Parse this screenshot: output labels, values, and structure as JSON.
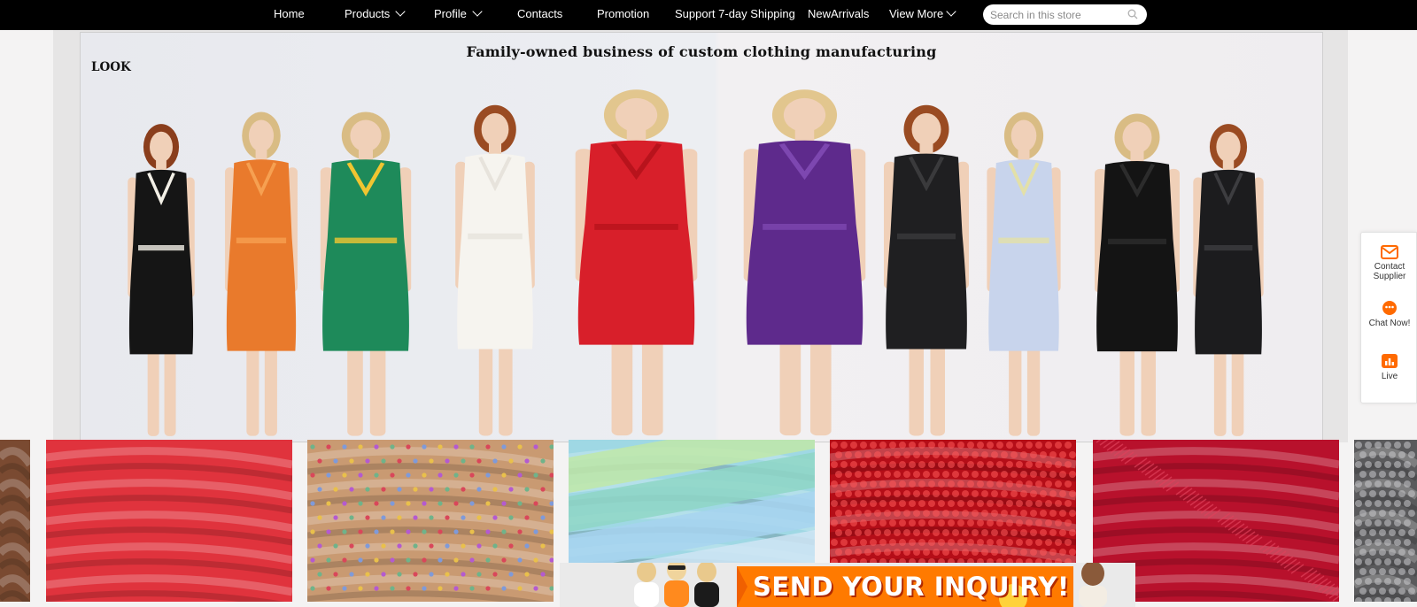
{
  "nav": {
    "items": [
      {
        "label": "Home",
        "has_chevron": false
      },
      {
        "label": "Products",
        "has_chevron": true
      },
      {
        "label": "Profile",
        "has_chevron": true
      },
      {
        "label": "Contacts",
        "has_chevron": false
      },
      {
        "label": "Promotion",
        "has_chevron": false
      },
      {
        "label": "Support 7-day Shipping",
        "has_chevron": false
      },
      {
        "label": "NewArrivals",
        "has_chevron": false
      },
      {
        "label": "View More",
        "has_chevron": true
      }
    ],
    "search_placeholder": "Search in this store",
    "search_icon": "search-icon"
  },
  "hero": {
    "title": "Family-owned business of custom clothing manufacturing",
    "look_label": "LOOK",
    "models": [
      {
        "dress": "black-white-knit-minidress",
        "dress_color": "#151515",
        "trim_color": "#f2efe6",
        "hair_color": "#8a3e1c"
      },
      {
        "dress": "orange-sequin-gown",
        "dress_color": "#e97a2c",
        "trim_color": "#f6a051",
        "hair_color": "#d9bc84"
      },
      {
        "dress": "green-print-maxi",
        "dress_color": "#1e8a5a",
        "trim_color": "#f0c531",
        "hair_color": "#d9bc84"
      },
      {
        "dress": "white-midi-dress",
        "dress_color": "#f6f4ef",
        "trim_color": "#e7e3dc",
        "hair_color": "#9a4b22"
      },
      {
        "dress": "red-corset-dress",
        "dress_color": "#d81f2a",
        "trim_color": "#b8131c",
        "hair_color": "#e2c68e"
      },
      {
        "dress": "purple-velvet-dress",
        "dress_color": "#5e2a8c",
        "trim_color": "#7d47b0",
        "hair_color": "#e2c68e"
      },
      {
        "dress": "black-satin-midi",
        "dress_color": "#1f1f21",
        "trim_color": "#3a3a3c",
        "hair_color": "#9a4b22"
      },
      {
        "dress": "floral-cutout-dress",
        "dress_color": "#c8d4ec",
        "trim_color": "#e3e0a8",
        "hair_color": "#d9bc84"
      },
      {
        "dress": "black-ruffle-dress",
        "dress_color": "#141414",
        "trim_color": "#2c2c2c",
        "hair_color": "#d9bc84"
      },
      {
        "dress": "black-sequin-minidress",
        "dress_color": "#1c1c1e",
        "trim_color": "#3d3d40",
        "hair_color": "#9a4b22"
      }
    ]
  },
  "widget": {
    "items": [
      {
        "label_lines": [
          "Contact",
          "Supplier"
        ],
        "icon": "envelope-icon"
      },
      {
        "label_lines": [
          "Chat Now!"
        ],
        "icon": "chat-icon"
      },
      {
        "label_lines": [
          "Live"
        ],
        "icon": "live-icon"
      }
    ],
    "accent": "#ff6a00"
  },
  "fabrics": [
    {
      "name": "brown-fabric",
      "color": "#7a4a31"
    },
    {
      "name": "red-satin-fabric",
      "color": "#e0333d"
    },
    {
      "name": "rhinestone-fabric",
      "color": "#c99a72"
    },
    {
      "name": "pastel-satin-fabric",
      "color": "#9fd8e4"
    },
    {
      "name": "red-sequin-fabric",
      "color": "#b50e18"
    },
    {
      "name": "red-feather-fabric",
      "color": "#b8112c"
    },
    {
      "name": "silver-sequin-fabric",
      "color": "#5a5a5c"
    }
  ],
  "inquiry_banner": {
    "text": "SEND YOUR INQUIRY!",
    "color": "#ff7a00"
  }
}
